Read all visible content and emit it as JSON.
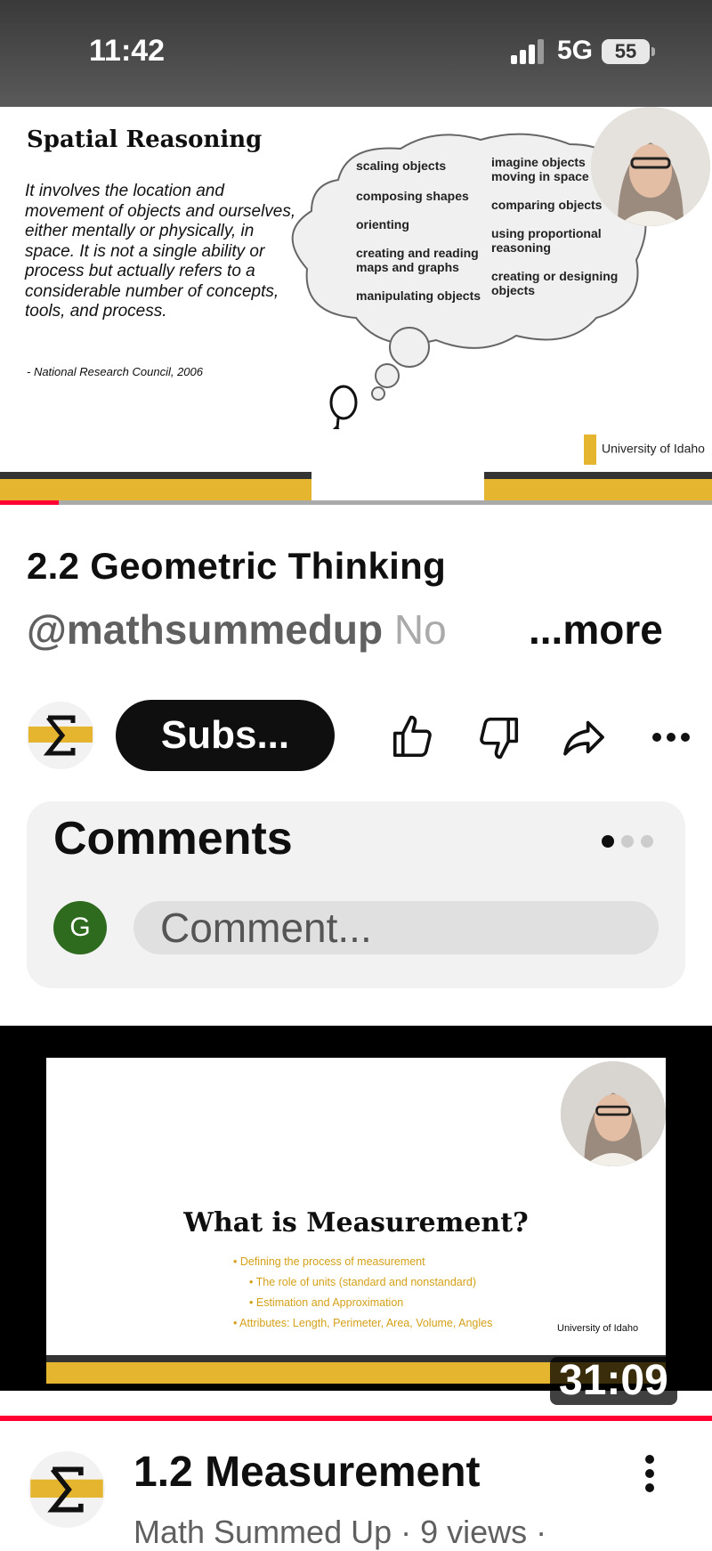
{
  "status_bar": {
    "time": "11:42",
    "network": "5G",
    "battery": "55"
  },
  "player": {
    "slide": {
      "title": "Spatial Reasoning",
      "quote": "It involves the location and movement of objects and ourselves, either mentally or physically, in space. It is not a single ability or process but actually refers to a considerable number of concepts, tools, and process.",
      "citation": "- National Research Council, 2006",
      "cloud_items": [
        "scaling objects",
        "composing shapes",
        "orienting",
        "creating and reading maps and graphs",
        "manipulating objects",
        "imagine objects moving in space",
        "comparing objects",
        "using proportional reasoning",
        "creating or designing objects"
      ],
      "logo": "University of Idaho"
    },
    "progress": 0.08
  },
  "video": {
    "title": "2.2 Geometric Thinking",
    "channel_handle": "@mathsummedup",
    "description_preview": "No",
    "more_label": "...more",
    "subscribe_label": "Subs..."
  },
  "comments": {
    "title": "Comments",
    "avatar_letter": "G",
    "placeholder": "Comment..."
  },
  "next_video": {
    "slide_title": "What is Measurement?",
    "bullets": [
      "Defining the process of measurement",
      "The role of units (standard and nonstandard)",
      "Estimation and Approximation",
      "Attributes: Length, Perimeter, Area, Volume, Angles"
    ],
    "logo": "University of Idaho",
    "duration": "31:09",
    "title": "1.2 Measurement",
    "meta": "Math Summed Up · 9 views ·"
  },
  "icons": [
    "signal-icon",
    "battery-icon",
    "sigma-channel-icon",
    "like-icon",
    "dislike-icon",
    "share-icon",
    "more-icon",
    "kebab-menu-icon"
  ],
  "colors": {
    "accent_gold": "#e6b530",
    "progress_red": "#ff0033",
    "avatar_green": "#2e6b1f"
  }
}
